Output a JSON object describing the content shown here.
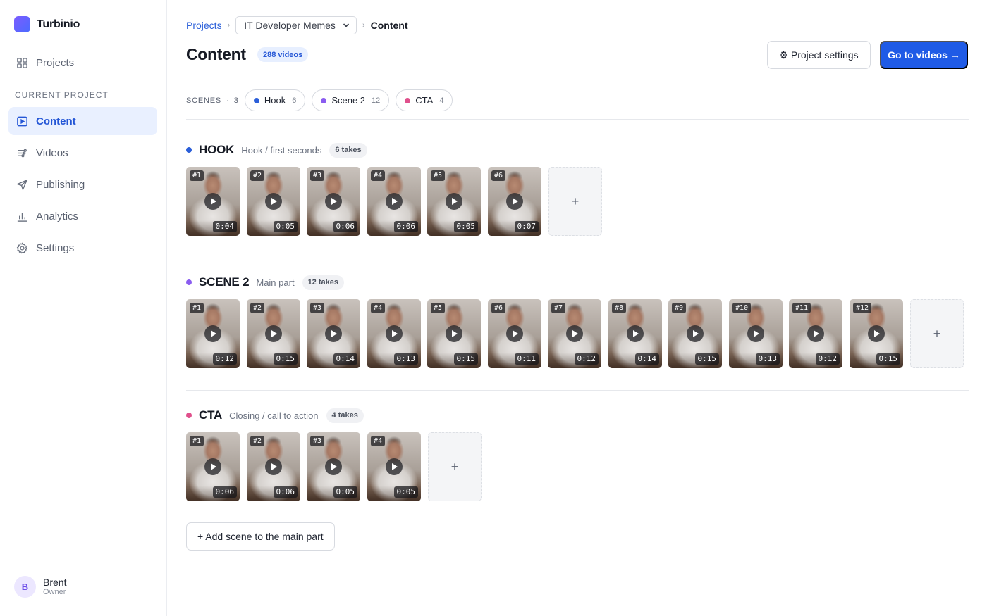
{
  "app": {
    "name": "Turbinio"
  },
  "sidebar": {
    "projects_label": "Projects",
    "section_label": "CURRENT PROJECT",
    "items": [
      {
        "label": "Content",
        "icon": "play-square-icon"
      },
      {
        "label": "Videos",
        "icon": "sliders-icon"
      },
      {
        "label": "Publishing",
        "icon": "send-icon"
      },
      {
        "label": "Analytics",
        "icon": "bar-chart-icon"
      },
      {
        "label": "Settings",
        "icon": "gear-icon"
      }
    ],
    "user": {
      "initial": "B",
      "name": "Brent",
      "role": "Owner"
    }
  },
  "breadcrumb": {
    "root": "Projects",
    "project": "IT Developer Memes",
    "current": "Content"
  },
  "header": {
    "title": "Content",
    "count": "288 videos",
    "settings_label": "⚙ Project settings",
    "primary_label": "Go to videos →"
  },
  "scenes_bar": {
    "label": "SCENES",
    "count": "3",
    "pills": [
      {
        "label": "Hook",
        "count": "6",
        "color": "#2b5fd9"
      },
      {
        "label": "Scene 2",
        "count": "12",
        "color": "#8a5cf0"
      },
      {
        "label": "CTA",
        "count": "4",
        "color": "#e0508c"
      }
    ]
  },
  "scenes": [
    {
      "name": "HOOK",
      "subtitle": "Hook / first seconds",
      "takes": "6 takes",
      "color": "#2b5fd9",
      "clips": [
        {
          "num": "#1",
          "dur": "0:04"
        },
        {
          "num": "#2",
          "dur": "0:05"
        },
        {
          "num": "#3",
          "dur": "0:06"
        },
        {
          "num": "#4",
          "dur": "0:06"
        },
        {
          "num": "#5",
          "dur": "0:05"
        },
        {
          "num": "#6",
          "dur": "0:07"
        }
      ]
    },
    {
      "name": "SCENE 2",
      "subtitle": "Main part",
      "takes": "12 takes",
      "color": "#8a5cf0",
      "clips": [
        {
          "num": "#1",
          "dur": "0:12"
        },
        {
          "num": "#2",
          "dur": "0:15"
        },
        {
          "num": "#3",
          "dur": "0:14"
        },
        {
          "num": "#4",
          "dur": "0:13"
        },
        {
          "num": "#5",
          "dur": "0:15"
        },
        {
          "num": "#6",
          "dur": "0:11"
        },
        {
          "num": "#7",
          "dur": "0:12"
        },
        {
          "num": "#8",
          "dur": "0:14"
        },
        {
          "num": "#9",
          "dur": "0:15"
        },
        {
          "num": "#10",
          "dur": "0:13"
        },
        {
          "num": "#11",
          "dur": "0:12"
        },
        {
          "num": "#12",
          "dur": "0:15"
        }
      ]
    },
    {
      "name": "CTA",
      "subtitle": "Closing / call to action",
      "takes": "4 takes",
      "color": "#e0508c",
      "clips": [
        {
          "num": "#1",
          "dur": "0:06"
        },
        {
          "num": "#2",
          "dur": "0:06"
        },
        {
          "num": "#3",
          "dur": "0:05"
        },
        {
          "num": "#4",
          "dur": "0:05"
        }
      ]
    }
  ],
  "add_take_label": "+",
  "add_scene_label": "+ Add scene to the main part"
}
